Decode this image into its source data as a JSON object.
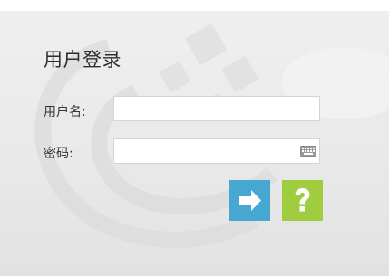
{
  "login": {
    "title": "用户登录",
    "username_label": "用户名:",
    "username_value": "",
    "password_label": "密码:",
    "password_value": "",
    "submit_icon": "arrow-right-icon",
    "help_icon": "question-mark-icon",
    "keyboard_icon": "keyboard-icon"
  },
  "colors": {
    "submit_button": "#47a7d3",
    "help_button": "#9fcd3f",
    "panel_background": "#ececec"
  }
}
